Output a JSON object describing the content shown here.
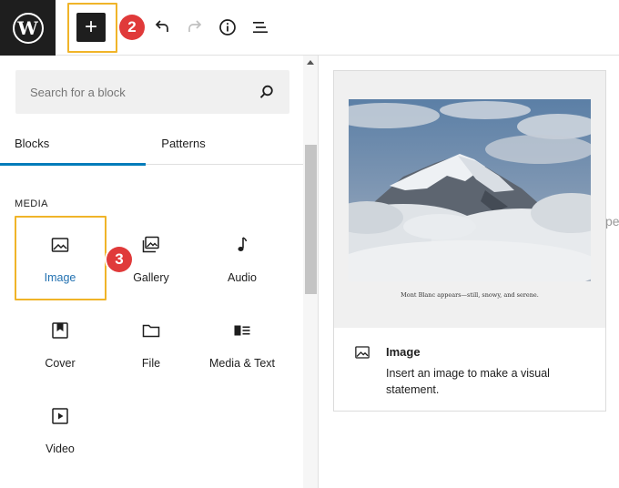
{
  "toolbar": {
    "logo_text": "W",
    "add_symbol": "+",
    "step_add": "2",
    "icons": [
      "undo-icon",
      "redo-icon",
      "info-icon",
      "list-view-icon"
    ]
  },
  "inserter": {
    "search": {
      "placeholder": "Search for a block",
      "value": ""
    },
    "tabs": [
      {
        "label": "Blocks",
        "active": true
      },
      {
        "label": "Patterns",
        "active": false
      }
    ],
    "section_title": "MEDIA",
    "step_image": "3",
    "blocks": [
      {
        "label": "Image",
        "icon": "image-icon",
        "selected": true
      },
      {
        "label": "Gallery",
        "icon": "gallery-icon"
      },
      {
        "label": "Audio",
        "icon": "audio-icon"
      },
      {
        "label": "Cover",
        "icon": "cover-icon"
      },
      {
        "label": "File",
        "icon": "file-icon"
      },
      {
        "label": "Media & Text",
        "icon": "media-text-icon"
      },
      {
        "label": "Video",
        "icon": "video-icon"
      }
    ]
  },
  "preview": {
    "caption": "Mont Blanc appears—still, snowy, and serene.",
    "title": "Image",
    "description": "Insert an image to make a visual statement."
  },
  "edge_text": "pe",
  "colors": {
    "accent": "#007cba",
    "highlight": "#f0b429",
    "badge": "#e03a3a",
    "dark": "#1e1e1e"
  }
}
